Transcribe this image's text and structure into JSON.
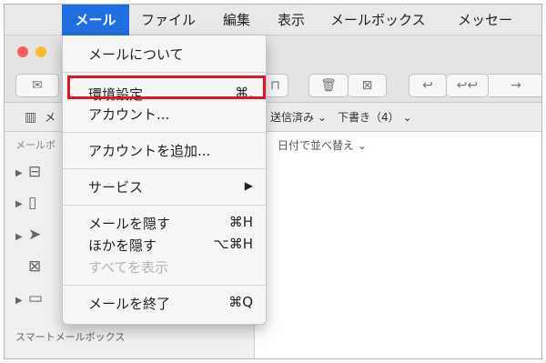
{
  "menubar": {
    "items": [
      {
        "label": "メール",
        "active": true
      },
      {
        "label": "ファイル"
      },
      {
        "label": "編集"
      },
      {
        "label": "表示"
      },
      {
        "label": "メールボックス"
      },
      {
        "label": "メッセー"
      }
    ]
  },
  "toolbar_visible": {
    "fav_sent": "送信済み ⌄",
    "fav_drafts": "下書き（4） ⌄",
    "fav_mail": "メ"
  },
  "sidebar": {
    "header": "メールボ",
    "footer": "スマートメールボックス"
  },
  "list": {
    "sort_label": "日付で並べ替え ⌄"
  },
  "menu": {
    "items": [
      {
        "label": "メールについて",
        "shortcut": ""
      },
      {
        "label": "環境設定...",
        "shortcut": "⌘,"
      },
      {
        "label": "アカウント...",
        "shortcut": ""
      },
      {
        "label": "アカウントを追加...",
        "shortcut": ""
      },
      {
        "label": "サービス",
        "shortcut": "▶"
      },
      {
        "label": "メールを隠す",
        "shortcut": "⌘H"
      },
      {
        "label": "ほかを隠す",
        "shortcut": "⌥⌘H"
      },
      {
        "label": "すべてを表示",
        "shortcut": "",
        "disabled": true
      },
      {
        "label": "メールを終了",
        "shortcut": "⌘Q"
      }
    ]
  },
  "colors": {
    "accent": "#1f6fe0",
    "highlight_box": "#e8141b"
  }
}
